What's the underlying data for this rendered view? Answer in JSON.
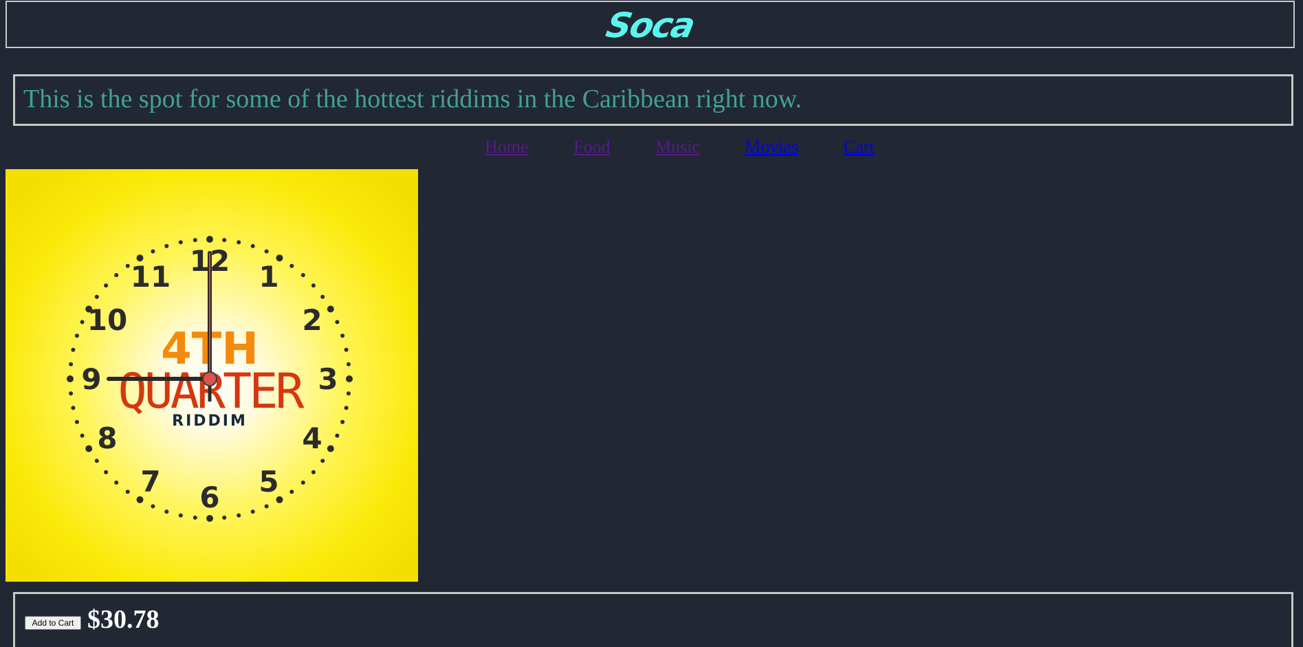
{
  "header": {
    "title": "Soca"
  },
  "tagline": "This is the spot for some of the hottest riddims in the Caribbean right now.",
  "nav": {
    "items": [
      {
        "label": "Home",
        "state": "visited"
      },
      {
        "label": "Food",
        "state": "visited"
      },
      {
        "label": "Music",
        "state": "visited"
      },
      {
        "label": "Movies",
        "state": "unvisited"
      },
      {
        "label": "Cart",
        "state": "unvisited"
      }
    ]
  },
  "album": {
    "line1": "4TH",
    "line2": "QUARTER",
    "line3": "RIDDIM",
    "clock_numbers": [
      "12",
      "1",
      "2",
      "3",
      "4",
      "5",
      "6",
      "7",
      "8",
      "9",
      "10",
      "11"
    ]
  },
  "purchase": {
    "add_to_cart_label": "Add to Cart",
    "price": "$30.78"
  },
  "colors": {
    "background": "#212733",
    "title": "#5cf5ee",
    "tagline": "#41a28f",
    "visited_link": "#551a8b",
    "link": "#0000ee",
    "album_yellow": "#fbe90a",
    "album_orange": "#f58a0c",
    "album_red": "#d4380f"
  }
}
